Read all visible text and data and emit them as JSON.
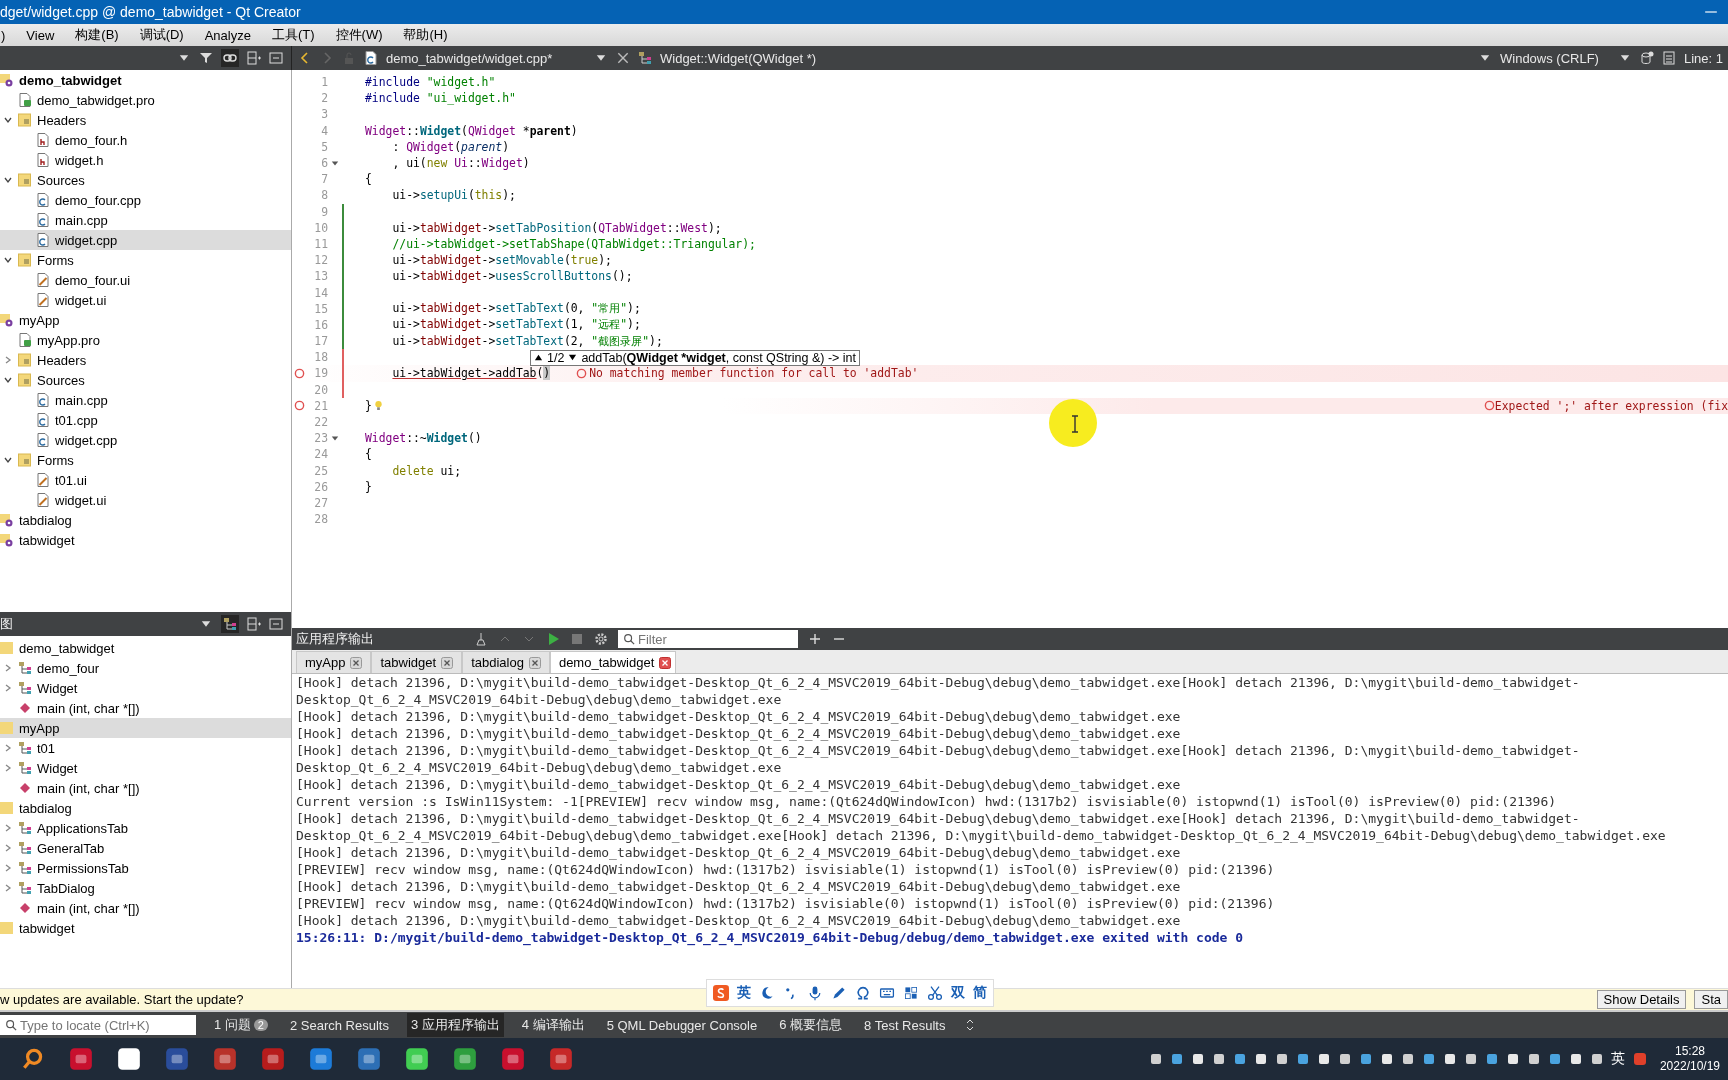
{
  "window": {
    "title": "dget/widget.cpp @ demo_tabwidget - Qt Creator"
  },
  "menu": [
    ")",
    "View",
    "构建(B)",
    "调试(D)",
    "Analyze",
    "工具(T)",
    "控件(W)",
    "帮助(H)"
  ],
  "editor_toolbar": {
    "file": "demo_tabwidget/widget.cpp*",
    "symbol": "Widget::Widget(QWidget *)",
    "line_ending": "Windows (CRLF)",
    "position": "Line: 1"
  },
  "project_tree": [
    {
      "label": "demo_tabwidget",
      "kind": "project",
      "active": true,
      "selected": false,
      "children": [
        {
          "label": "demo_tabwidget.pro",
          "kind": "pro",
          "selected": false
        },
        {
          "label": "Headers",
          "kind": "folder",
          "expanded": true,
          "selected": false,
          "children": [
            {
              "label": "demo_four.h",
              "kind": "header",
              "selected": false
            },
            {
              "label": "widget.h",
              "kind": "header",
              "selected": false
            }
          ]
        },
        {
          "label": "Sources",
          "kind": "folder",
          "expanded": true,
          "selected": false,
          "children": [
            {
              "label": "demo_four.cpp",
              "kind": "source",
              "selected": false
            },
            {
              "label": "main.cpp",
              "kind": "source",
              "selected": false
            },
            {
              "label": "widget.cpp",
              "kind": "source",
              "selected": true
            }
          ]
        },
        {
          "label": "Forms",
          "kind": "folder",
          "expanded": true,
          "selected": false,
          "children": [
            {
              "label": "demo_four.ui",
              "kind": "form",
              "selected": false
            },
            {
              "label": "widget.ui",
              "kind": "form",
              "selected": false
            }
          ]
        }
      ]
    },
    {
      "label": "myApp",
      "kind": "project",
      "active": false,
      "selected": false,
      "children": [
        {
          "label": "myApp.pro",
          "kind": "pro",
          "selected": false
        },
        {
          "label": "Headers",
          "kind": "folder",
          "expanded": false,
          "selected": false
        },
        {
          "label": "Sources",
          "kind": "folder",
          "expanded": true,
          "selected": false,
          "children": [
            {
              "label": "main.cpp",
              "kind": "source",
              "selected": false
            },
            {
              "label": "t01.cpp",
              "kind": "source",
              "selected": false
            },
            {
              "label": "widget.cpp",
              "kind": "source",
              "selected": false
            }
          ]
        },
        {
          "label": "Forms",
          "kind": "folder",
          "expanded": true,
          "selected": false,
          "children": [
            {
              "label": "t01.ui",
              "kind": "form",
              "selected": false
            },
            {
              "label": "widget.ui",
              "kind": "form",
              "selected": false
            }
          ]
        }
      ]
    },
    {
      "label": "tabdialog",
      "kind": "project",
      "active": false,
      "selected": false
    },
    {
      "label": "tabwidget",
      "kind": "project",
      "active": false,
      "selected": false
    }
  ],
  "class_view": {
    "title": "图",
    "items": [
      {
        "label": "demo_tabwidget",
        "kind": "group",
        "selected": false,
        "children": [
          {
            "label": "demo_four",
            "kind": "class",
            "expanded": false,
            "selected": false
          },
          {
            "label": "Widget",
            "kind": "class",
            "expanded": false,
            "selected": false
          },
          {
            "label": "main (int, char *[])",
            "kind": "function",
            "selected": false
          }
        ]
      },
      {
        "label": "myApp",
        "kind": "group",
        "selected": true,
        "children": [
          {
            "label": "t01",
            "kind": "class",
            "expanded": false,
            "selected": false
          },
          {
            "label": "Widget",
            "kind": "class",
            "expanded": false,
            "selected": false
          },
          {
            "label": "main (int, char *[])",
            "kind": "function",
            "selected": false
          }
        ]
      },
      {
        "label": "tabdialog",
        "kind": "group",
        "selected": false,
        "children": [
          {
            "label": "ApplicationsTab",
            "kind": "class",
            "expanded": false,
            "selected": false
          },
          {
            "label": "GeneralTab",
            "kind": "class",
            "expanded": false,
            "selected": false
          },
          {
            "label": "PermissionsTab",
            "kind": "class",
            "expanded": false,
            "selected": false
          },
          {
            "label": "TabDialog",
            "kind": "class",
            "expanded": false,
            "selected": false
          },
          {
            "label": "main (int, char *[])",
            "kind": "function",
            "selected": false
          }
        ]
      },
      {
        "label": "tabwidget",
        "kind": "group",
        "selected": false
      }
    ]
  },
  "code_lines": [
    {
      "n": "1",
      "modified": false,
      "fold": false,
      "hint": false,
      "segments": [
        {
          "text": "#include",
          "kind": "pp"
        },
        {
          "text": " \"widget.h\"",
          "kind": "str"
        }
      ]
    },
    {
      "n": "2",
      "modified": false,
      "fold": false,
      "hint": false,
      "segments": [
        {
          "text": "#include",
          "kind": "pp"
        },
        {
          "text": " \"ui_widget.h\"",
          "kind": "str"
        }
      ]
    },
    {
      "n": "3",
      "modified": false,
      "fold": false,
      "hint": false
    },
    {
      "n": "4",
      "modified": false,
      "fold": false,
      "hint": false,
      "segments": [
        {
          "text": "Widget",
          "kind": "type"
        },
        {
          "text": "::",
          "kind": "plain"
        },
        {
          "text": "Widget",
          "kind": "decl"
        },
        {
          "text": "(",
          "kind": "plain"
        },
        {
          "text": "QWidget",
          "kind": "type"
        },
        {
          "text": " *",
          "kind": "plain"
        },
        {
          "text": "parent",
          "kind": "param"
        },
        {
          "text": ")",
          "kind": "plain"
        }
      ]
    },
    {
      "n": "5",
      "modified": false,
      "fold": false,
      "hint": false,
      "segments": [
        {
          "text": "    : ",
          "kind": "plain"
        },
        {
          "text": "QWidget",
          "kind": "type"
        },
        {
          "text": "(",
          "kind": "plain"
        },
        {
          "text": "parent",
          "kind": "paramuse"
        },
        {
          "text": ")",
          "kind": "plain"
        }
      ]
    },
    {
      "n": "6",
      "modified": false,
      "fold": true,
      "hint": false,
      "segments": [
        {
          "text": "    , ui(",
          "kind": "plain"
        },
        {
          "text": "new",
          "kind": "kw"
        },
        {
          "text": " Ui",
          "kind": "type"
        },
        {
          "text": "::",
          "kind": "plain"
        },
        {
          "text": "Widget",
          "kind": "type"
        },
        {
          "text": ")",
          "kind": "plain"
        }
      ]
    },
    {
      "n": "7",
      "modified": false,
      "fold": false,
      "hint": false,
      "segments": [
        {
          "text": "{",
          "kind": "plain"
        }
      ]
    },
    {
      "n": "8",
      "modified": false,
      "fold": false,
      "hint": false,
      "segments": [
        {
          "text": "    ui->",
          "kind": "plain"
        },
        {
          "text": "setupUi",
          "kind": "fn"
        },
        {
          "text": "(",
          "kind": "plain"
        },
        {
          "text": "this",
          "kind": "kw"
        },
        {
          "text": ");",
          "kind": "plain"
        }
      ]
    },
    {
      "n": "9",
      "modified": true,
      "saved": true,
      "fold": false,
      "hint": false
    },
    {
      "n": "10",
      "modified": true,
      "saved": true,
      "fold": false,
      "hint": false,
      "segments": [
        {
          "text": "    ui->",
          "kind": "plain"
        },
        {
          "text": "tabWidget",
          "kind": "member"
        },
        {
          "text": "->",
          "kind": "plain"
        },
        {
          "text": "setTabPosition",
          "kind": "fn"
        },
        {
          "text": "(",
          "kind": "plain"
        },
        {
          "text": "QTabWidget",
          "kind": "type"
        },
        {
          "text": "::",
          "kind": "plain"
        },
        {
          "text": "West",
          "kind": "type"
        },
        {
          "text": ");",
          "kind": "plain"
        }
      ]
    },
    {
      "n": "11",
      "modified": true,
      "saved": true,
      "fold": false,
      "hint": false,
      "segments": [
        {
          "text": "    //ui->tabWidget->setTabShape(QTabWidget::Triangular);",
          "kind": "comment"
        }
      ]
    },
    {
      "n": "12",
      "modified": true,
      "saved": true,
      "fold": false,
      "hint": false,
      "segments": [
        {
          "text": "    ui->",
          "kind": "plain"
        },
        {
          "text": "tabWidget",
          "kind": "member"
        },
        {
          "text": "->",
          "kind": "plain"
        },
        {
          "text": "setMovable",
          "kind": "fn"
        },
        {
          "text": "(",
          "kind": "plain"
        },
        {
          "text": "true",
          "kind": "kw"
        },
        {
          "text": ");",
          "kind": "plain"
        }
      ]
    },
    {
      "n": "13",
      "modified": true,
      "saved": true,
      "fold": false,
      "hint": false,
      "segments": [
        {
          "text": "    ui->",
          "kind": "plain"
        },
        {
          "text": "tabWidget",
          "kind": "member"
        },
        {
          "text": "->",
          "kind": "plain"
        },
        {
          "text": "usesScrollButtons",
          "kind": "fn"
        },
        {
          "text": "();",
          "kind": "plain"
        }
      ]
    },
    {
      "n": "14",
      "modified": true,
      "saved": true,
      "fold": false,
      "hint": false
    },
    {
      "n": "15",
      "modified": true,
      "saved": true,
      "fold": false,
      "hint": false,
      "segments": [
        {
          "text": "    ui->",
          "kind": "plain"
        },
        {
          "text": "tabWidget",
          "kind": "member"
        },
        {
          "text": "->",
          "kind": "plain"
        },
        {
          "text": "setTabText",
          "kind": "fn"
        },
        {
          "text": "(0, ",
          "kind": "plain"
        },
        {
          "text": "\"常用\"",
          "kind": "str"
        },
        {
          "text": ");",
          "kind": "plain"
        }
      ]
    },
    {
      "n": "16",
      "modified": true,
      "saved": true,
      "fold": false,
      "hint": false,
      "segments": [
        {
          "text": "    ui->",
          "kind": "plain"
        },
        {
          "text": "tabWidget",
          "kind": "member"
        },
        {
          "text": "->",
          "kind": "plain"
        },
        {
          "text": "setTabText",
          "kind": "fn"
        },
        {
          "text": "(1, ",
          "kind": "plain"
        },
        {
          "text": "\"远程\"",
          "kind": "str"
        },
        {
          "text": ");",
          "kind": "plain"
        }
      ]
    },
    {
      "n": "17",
      "modified": true,
      "saved": true,
      "fold": false,
      "hint": false,
      "segments": [
        {
          "text": "    ui->",
          "kind": "plain"
        },
        {
          "text": "tabWidget",
          "kind": "member"
        },
        {
          "text": "->",
          "kind": "plain"
        },
        {
          "text": "setTabText",
          "kind": "fn"
        },
        {
          "text": "(2, ",
          "kind": "plain"
        },
        {
          "text": "\"截图录屏\"",
          "kind": "str"
        },
        {
          "text": ");",
          "kind": "plain"
        }
      ]
    },
    {
      "n": "18",
      "modified": true,
      "saved": false,
      "fold": false,
      "hint": false
    },
    {
      "n": "19",
      "modified": true,
      "saved": false,
      "fold": false,
      "hint": false,
      "segments": [
        {
          "text": "    ui->tabWidget->addTab",
          "kind": "err"
        },
        {
          "text": "(",
          "kind": "plain"
        },
        {
          "text": ")",
          "kind": "match"
        }
      ],
      "error": {
        "text": "No matching member function for call to 'addTab'",
        "kind": "inline"
      }
    },
    {
      "n": "20",
      "modified": true,
      "saved": false,
      "fold": false,
      "hint": false
    },
    {
      "n": "21",
      "modified": false,
      "fold": false,
      "hint": true,
      "segments": [
        {
          "text": "}",
          "kind": "plain"
        }
      ],
      "error": {
        "text": "Expected ';' after expression (fix",
        "kind": "edge"
      }
    },
    {
      "n": "22",
      "modified": false,
      "fold": false,
      "hint": false
    },
    {
      "n": "23",
      "modified": false,
      "fold": true,
      "hint": false,
      "segments": [
        {
          "text": "Widget",
          "kind": "type"
        },
        {
          "text": "::~",
          "kind": "plain"
        },
        {
          "text": "Widget",
          "kind": "decl"
        },
        {
          "text": "()",
          "kind": "plain"
        }
      ]
    },
    {
      "n": "24",
      "modified": false,
      "fold": false,
      "hint": false,
      "segments": [
        {
          "text": "{",
          "kind": "plain"
        }
      ]
    },
    {
      "n": "25",
      "modified": false,
      "fold": false,
      "hint": false,
      "segments": [
        {
          "text": "    delete",
          "kind": "kw"
        },
        {
          "text": " ui;",
          "kind": "plain"
        }
      ]
    },
    {
      "n": "26",
      "modified": false,
      "fold": false,
      "hint": false,
      "segments": [
        {
          "text": "}",
          "kind": "plain"
        }
      ]
    },
    {
      "n": "27",
      "modified": false,
      "fold": false,
      "hint": false
    },
    {
      "n": "28",
      "modified": false,
      "fold": false,
      "hint": false
    }
  ],
  "tooltip": {
    "counter": "1/2",
    "signature": "addTab(**QWidget *widget**, const QString &) -> int"
  },
  "output": {
    "title": "应用程序输出",
    "filter_placeholder": "Filter",
    "tabs": [
      {
        "label": "myApp",
        "selected": false
      },
      {
        "label": "tabwidget",
        "selected": false
      },
      {
        "label": "tabdialog",
        "selected": false
      },
      {
        "label": "demo_tabwidget",
        "selected": true
      }
    ],
    "lines": [
      {
        "kind": "log",
        "text": "[Hook] detach 21396, D:\\mygit\\build-demo_tabwidget-Desktop_Qt_6_2_4_MSVC2019_64bit-Debug\\debug\\demo_tabwidget.exe[Hook] detach 21396, D:\\mygit\\build-demo_tabwidget-"
      },
      {
        "kind": "log",
        "text": "Desktop_Qt_6_2_4_MSVC2019_64bit-Debug\\debug\\demo_tabwidget.exe"
      },
      {
        "kind": "log",
        "text": "[Hook] detach 21396, D:\\mygit\\build-demo_tabwidget-Desktop_Qt_6_2_4_MSVC2019_64bit-Debug\\debug\\demo_tabwidget.exe"
      },
      {
        "kind": "log",
        "text": "[Hook] detach 21396, D:\\mygit\\build-demo_tabwidget-Desktop_Qt_6_2_4_MSVC2019_64bit-Debug\\debug\\demo_tabwidget.exe"
      },
      {
        "kind": "log",
        "text": "[Hook] detach 21396, D:\\mygit\\build-demo_tabwidget-Desktop_Qt_6_2_4_MSVC2019_64bit-Debug\\debug\\demo_tabwidget.exe[Hook] detach 21396, D:\\mygit\\build-demo_tabwidget-"
      },
      {
        "kind": "log",
        "text": "Desktop_Qt_6_2_4_MSVC2019_64bit-Debug\\debug\\demo_tabwidget.exe"
      },
      {
        "kind": "log",
        "text": "[Hook] detach 21396, D:\\mygit\\build-demo_tabwidget-Desktop_Qt_6_2_4_MSVC2019_64bit-Debug\\debug\\demo_tabwidget.exe"
      },
      {
        "kind": "log",
        "text": "Current version :s IsWin11System: -1[PREVIEW] recv window msg, name:(Qt624dQWindowIcon) hwd:(1317b2) isvisiable(0) istopwnd(1) isTool(0) isPreview(0) pid:(21396)"
      },
      {
        "kind": "log",
        "text": "[Hook] detach 21396, D:\\mygit\\build-demo_tabwidget-Desktop_Qt_6_2_4_MSVC2019_64bit-Debug\\debug\\demo_tabwidget.exe[Hook] detach 21396, D:\\mygit\\build-demo_tabwidget-"
      },
      {
        "kind": "log",
        "text": "Desktop_Qt_6_2_4_MSVC2019_64bit-Debug\\debug\\demo_tabwidget.exe[Hook] detach 21396, D:\\mygit\\build-demo_tabwidget-Desktop_Qt_6_2_4_MSVC2019_64bit-Debug\\debug\\demo_tabwidget.exe"
      },
      {
        "kind": "log",
        "text": "[Hook] detach 21396, D:\\mygit\\build-demo_tabwidget-Desktop_Qt_6_2_4_MSVC2019_64bit-Debug\\debug\\demo_tabwidget.exe"
      },
      {
        "kind": "log",
        "text": "[PREVIEW] recv window msg, name:(Qt624dQWindowIcon) hwd:(1317b2) isvisiable(1) istopwnd(1) isTool(0) isPreview(0) pid:(21396)"
      },
      {
        "kind": "log",
        "text": "[Hook] detach 21396, D:\\mygit\\build-demo_tabwidget-Desktop_Qt_6_2_4_MSVC2019_64bit-Debug\\debug\\demo_tabwidget.exe"
      },
      {
        "kind": "log",
        "text": "[PREVIEW] recv window msg, name:(Qt624dQWindowIcon) hwd:(1317b2) isvisiable(0) istopwnd(1) isTool(0) isPreview(0) pid:(21396)"
      },
      {
        "kind": "log",
        "text": "[Hook] detach 21396, D:\\mygit\\build-demo_tabwidget-Desktop_Qt_6_2_4_MSVC2019_64bit-Debug\\debug\\demo_tabwidget.exe"
      },
      {
        "kind": "exit",
        "text": "15:26:11: D:/mygit/build-demo_tabwidget-Desktop_Qt_6_2_4_MSVC2019_64bit-Debug/debug/demo_tabwidget.exe exited with code 0"
      }
    ]
  },
  "ime_bar": {
    "language": "英",
    "width": "双",
    "script": "简"
  },
  "update_bar": {
    "message": "w updates are available. Start the update?",
    "buttons": [
      "Show Details",
      "Sta"
    ]
  },
  "locator": {
    "placeholder": "Type to locate (Ctrl+K)"
  },
  "panes": [
    {
      "label": "1 问题",
      "badge": "2",
      "selected": false
    },
    {
      "label": "2 Search Results",
      "selected": false
    },
    {
      "label": "3 应用程序输出",
      "selected": true
    },
    {
      "label": "4 编译输出",
      "selected": false
    },
    {
      "label": "5 QML Debugger Console",
      "selected": false
    },
    {
      "label": "6 概要信息",
      "selected": false
    },
    {
      "label": "8 Test Results",
      "selected": false
    }
  ],
  "taskbar": {
    "ime": "英",
    "time": "15:28",
    "date": "2022/10/19"
  }
}
